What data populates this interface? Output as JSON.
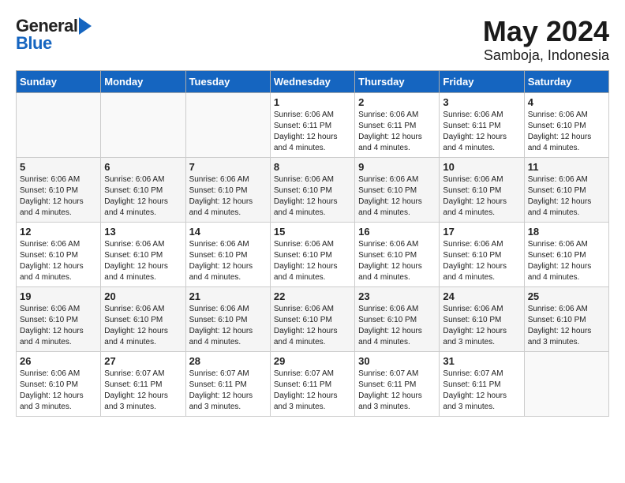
{
  "header": {
    "logo_general": "General",
    "logo_blue": "Blue",
    "month_year": "May 2024",
    "location": "Samboja, Indonesia"
  },
  "weekdays": [
    "Sunday",
    "Monday",
    "Tuesday",
    "Wednesday",
    "Thursday",
    "Friday",
    "Saturday"
  ],
  "weeks": [
    [
      {
        "day": "",
        "info": ""
      },
      {
        "day": "",
        "info": ""
      },
      {
        "day": "",
        "info": ""
      },
      {
        "day": "1",
        "info": "Sunrise: 6:06 AM\nSunset: 6:11 PM\nDaylight: 12 hours\nand 4 minutes."
      },
      {
        "day": "2",
        "info": "Sunrise: 6:06 AM\nSunset: 6:11 PM\nDaylight: 12 hours\nand 4 minutes."
      },
      {
        "day": "3",
        "info": "Sunrise: 6:06 AM\nSunset: 6:11 PM\nDaylight: 12 hours\nand 4 minutes."
      },
      {
        "day": "4",
        "info": "Sunrise: 6:06 AM\nSunset: 6:10 PM\nDaylight: 12 hours\nand 4 minutes."
      }
    ],
    [
      {
        "day": "5",
        "info": "Sunrise: 6:06 AM\nSunset: 6:10 PM\nDaylight: 12 hours\nand 4 minutes."
      },
      {
        "day": "6",
        "info": "Sunrise: 6:06 AM\nSunset: 6:10 PM\nDaylight: 12 hours\nand 4 minutes."
      },
      {
        "day": "7",
        "info": "Sunrise: 6:06 AM\nSunset: 6:10 PM\nDaylight: 12 hours\nand 4 minutes."
      },
      {
        "day": "8",
        "info": "Sunrise: 6:06 AM\nSunset: 6:10 PM\nDaylight: 12 hours\nand 4 minutes."
      },
      {
        "day": "9",
        "info": "Sunrise: 6:06 AM\nSunset: 6:10 PM\nDaylight: 12 hours\nand 4 minutes."
      },
      {
        "day": "10",
        "info": "Sunrise: 6:06 AM\nSunset: 6:10 PM\nDaylight: 12 hours\nand 4 minutes."
      },
      {
        "day": "11",
        "info": "Sunrise: 6:06 AM\nSunset: 6:10 PM\nDaylight: 12 hours\nand 4 minutes."
      }
    ],
    [
      {
        "day": "12",
        "info": "Sunrise: 6:06 AM\nSunset: 6:10 PM\nDaylight: 12 hours\nand 4 minutes."
      },
      {
        "day": "13",
        "info": "Sunrise: 6:06 AM\nSunset: 6:10 PM\nDaylight: 12 hours\nand 4 minutes."
      },
      {
        "day": "14",
        "info": "Sunrise: 6:06 AM\nSunset: 6:10 PM\nDaylight: 12 hours\nand 4 minutes."
      },
      {
        "day": "15",
        "info": "Sunrise: 6:06 AM\nSunset: 6:10 PM\nDaylight: 12 hours\nand 4 minutes."
      },
      {
        "day": "16",
        "info": "Sunrise: 6:06 AM\nSunset: 6:10 PM\nDaylight: 12 hours\nand 4 minutes."
      },
      {
        "day": "17",
        "info": "Sunrise: 6:06 AM\nSunset: 6:10 PM\nDaylight: 12 hours\nand 4 minutes."
      },
      {
        "day": "18",
        "info": "Sunrise: 6:06 AM\nSunset: 6:10 PM\nDaylight: 12 hours\nand 4 minutes."
      }
    ],
    [
      {
        "day": "19",
        "info": "Sunrise: 6:06 AM\nSunset: 6:10 PM\nDaylight: 12 hours\nand 4 minutes."
      },
      {
        "day": "20",
        "info": "Sunrise: 6:06 AM\nSunset: 6:10 PM\nDaylight: 12 hours\nand 4 minutes."
      },
      {
        "day": "21",
        "info": "Sunrise: 6:06 AM\nSunset: 6:10 PM\nDaylight: 12 hours\nand 4 minutes."
      },
      {
        "day": "22",
        "info": "Sunrise: 6:06 AM\nSunset: 6:10 PM\nDaylight: 12 hours\nand 4 minutes."
      },
      {
        "day": "23",
        "info": "Sunrise: 6:06 AM\nSunset: 6:10 PM\nDaylight: 12 hours\nand 4 minutes."
      },
      {
        "day": "24",
        "info": "Sunrise: 6:06 AM\nSunset: 6:10 PM\nDaylight: 12 hours\nand 3 minutes."
      },
      {
        "day": "25",
        "info": "Sunrise: 6:06 AM\nSunset: 6:10 PM\nDaylight: 12 hours\nand 3 minutes."
      }
    ],
    [
      {
        "day": "26",
        "info": "Sunrise: 6:06 AM\nSunset: 6:10 PM\nDaylight: 12 hours\nand 3 minutes."
      },
      {
        "day": "27",
        "info": "Sunrise: 6:07 AM\nSunset: 6:11 PM\nDaylight: 12 hours\nand 3 minutes."
      },
      {
        "day": "28",
        "info": "Sunrise: 6:07 AM\nSunset: 6:11 PM\nDaylight: 12 hours\nand 3 minutes."
      },
      {
        "day": "29",
        "info": "Sunrise: 6:07 AM\nSunset: 6:11 PM\nDaylight: 12 hours\nand 3 minutes."
      },
      {
        "day": "30",
        "info": "Sunrise: 6:07 AM\nSunset: 6:11 PM\nDaylight: 12 hours\nand 3 minutes."
      },
      {
        "day": "31",
        "info": "Sunrise: 6:07 AM\nSunset: 6:11 PM\nDaylight: 12 hours\nand 3 minutes."
      },
      {
        "day": "",
        "info": ""
      }
    ]
  ]
}
